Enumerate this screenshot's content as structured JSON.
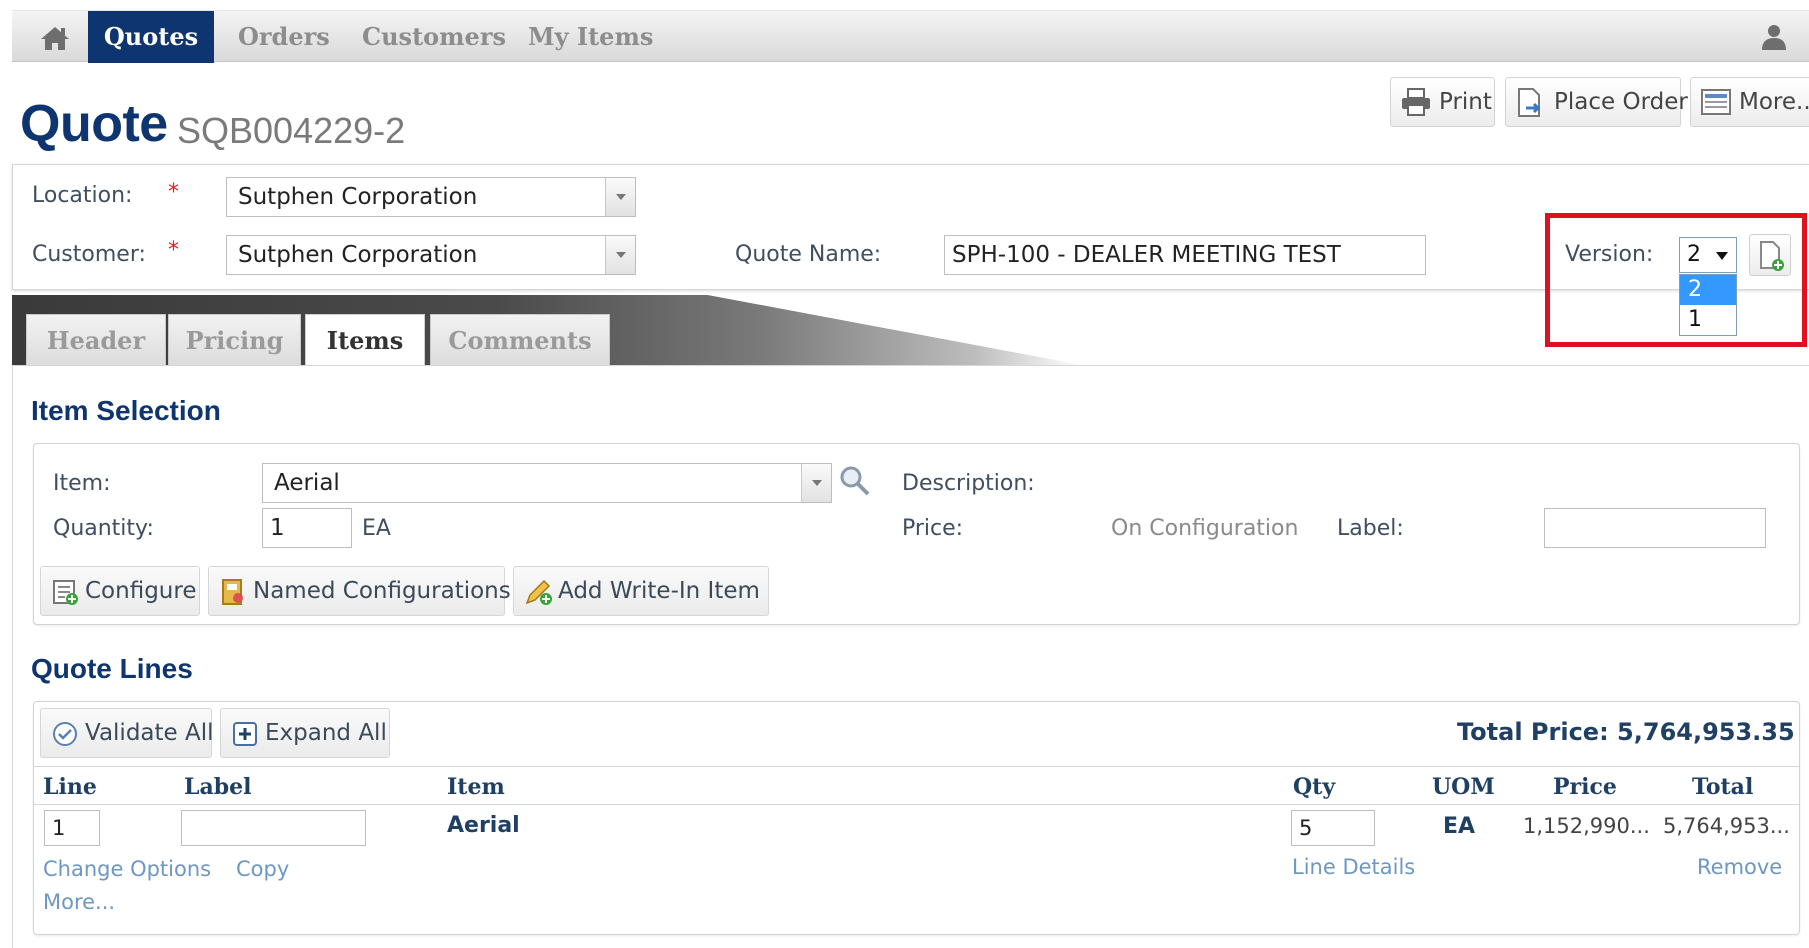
{
  "nav": {
    "tabs": [
      "Quotes",
      "Orders",
      "Customers",
      "My Items"
    ],
    "active_tab": "Quotes"
  },
  "page": {
    "title": "Quote",
    "quote_number": "SQB004229-2"
  },
  "toolbar": {
    "print": "Print",
    "place_order": "Place Order",
    "more": "More..."
  },
  "header": {
    "location_label": "Location:",
    "location_value": "Sutphen Corporation",
    "customer_label": "Customer:",
    "customer_value": "Sutphen Corporation",
    "required_mark": "*",
    "quote_name_label": "Quote Name:",
    "quote_name_value": "SPH-100 - DEALER MEETING TEST",
    "version_label": "Version:",
    "version_selected": "2",
    "version_options": [
      "2",
      "1"
    ]
  },
  "tabs": [
    "Header",
    "Pricing",
    "Items",
    "Comments"
  ],
  "active_tab": "Items",
  "item_selection": {
    "title": "Item Selection",
    "item_label": "Item:",
    "item_value": "Aerial",
    "quantity_label": "Quantity:",
    "quantity_value": "1",
    "uom": "EA",
    "description_label": "Description:",
    "price_label": "Price:",
    "price_value": "On Configuration",
    "label_label": "Label:",
    "label_value": "",
    "buttons": {
      "configure": "Configure",
      "named_configurations": "Named Configurations",
      "add_write_in": "Add Write-In Item"
    }
  },
  "quote_lines": {
    "title": "Quote Lines",
    "validate_all": "Validate All",
    "expand_all": "Expand All",
    "total_price_label": "Total Price:",
    "total_price_value": "5,764,953.35",
    "columns": [
      "Line",
      "Label",
      "Item",
      "Qty",
      "UOM",
      "Price",
      "Total"
    ],
    "rows": [
      {
        "line": "1",
        "label": "",
        "item": "Aerial",
        "qty": "5",
        "uom": "EA",
        "price": "1,152,990...",
        "total": "5,764,953...",
        "links": {
          "change_options": "Change Options",
          "copy": "Copy",
          "more": "More...",
          "line_details": "Line Details",
          "remove": "Remove"
        }
      }
    ]
  },
  "colors": {
    "brand_navy": "#0f3570",
    "highlight_red": "#e01020",
    "link_blue": "#6d97c4",
    "selected_option": "#3399ff"
  }
}
